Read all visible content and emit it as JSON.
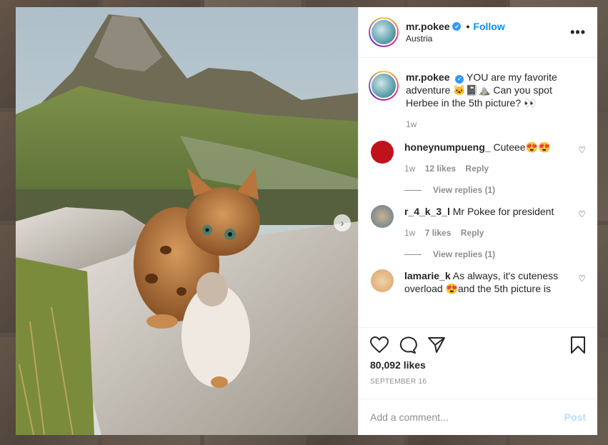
{
  "post": {
    "username": "mr.pokee",
    "follow_label": "Follow",
    "location": "Austria",
    "more_label": "•••",
    "caption": "YOU are my favorite adventure 🐱📓⛰️ Can you spot Herbee in the 5th picture? 👀",
    "caption_time": "1w",
    "likes": "80,092 likes",
    "date": "SEPTEMBER 16"
  },
  "comments": [
    {
      "username": "honeynumpueng_",
      "text": "Cuteee😍😍",
      "time": "1w",
      "likes": "12 likes",
      "reply": "Reply",
      "view_replies": "View replies (1)",
      "avatar_color": "#c0121a"
    },
    {
      "username": "r_4_k_3_l",
      "text": "Mr Pokee for president",
      "time": "1w",
      "likes": "7 likes",
      "reply": "Reply",
      "view_replies": "View replies (1)",
      "avatar_color": "#5a7a94"
    },
    {
      "username": "lamarie_k",
      "text": "As always, it's cuteness overload 😍and the 5th picture is",
      "avatar_color": "#d9a26b"
    }
  ],
  "add_comment": {
    "placeholder": "Add a comment...",
    "post_label": "Post"
  },
  "icons": {
    "like": "heart-icon",
    "comment": "comment-icon",
    "share": "share-icon",
    "save": "bookmark-icon",
    "next": "chevron-right-icon"
  },
  "colors": {
    "accent": "#0095f6",
    "verified": "#3897f0",
    "post_disabled": "#b2dffc"
  }
}
